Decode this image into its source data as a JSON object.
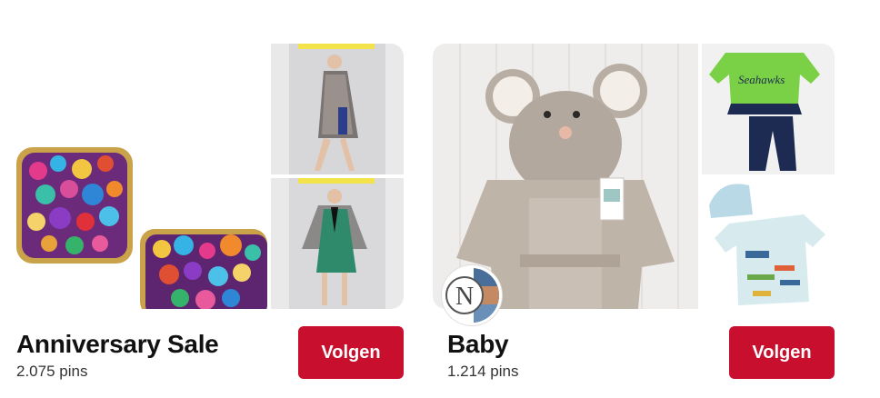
{
  "boards": [
    {
      "title": "Anniversary Sale",
      "pin_count": "2.075 pins",
      "follow_label": "Volgen",
      "images": {
        "main": "glitter-earrings",
        "top_right": "woman-plaid-coat",
        "bottom_right": "woman-green-dress-cardigan"
      }
    },
    {
      "title": "Baby",
      "pin_count": "1.214 pins",
      "follow_label": "Volgen",
      "owner_avatar": "nordstrom-logo-avatar",
      "images": {
        "main": "mouse-hooded-baby-robe",
        "top_right": "seahawks-baby-outfit",
        "bottom_right": "map-print-onesie-and-hat"
      }
    }
  ],
  "colors": {
    "follow_button": "#c8102e",
    "title_text": "#111111",
    "count_text": "#333333"
  }
}
